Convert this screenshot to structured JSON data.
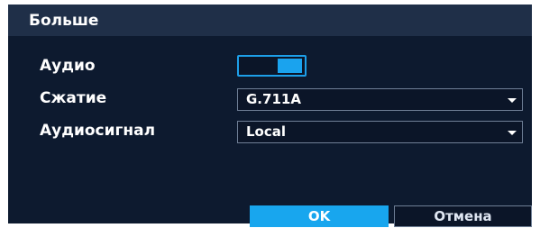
{
  "dialog": {
    "title": "Больше"
  },
  "fields": {
    "audio": {
      "label": "Аудио",
      "enabled": true
    },
    "compression": {
      "label": "Сжатие",
      "value": "G.711A"
    },
    "audio_signal": {
      "label": "Аудиосигнал",
      "value": "Local"
    }
  },
  "buttons": {
    "ok": "OK",
    "cancel": "Отмена"
  },
  "colors": {
    "accent": "#18a6ee",
    "dialog_background": "#0d1a2f",
    "titlebar_background": "#1f2f48"
  },
  "icons": {
    "dropdown": "chevron-down-icon"
  }
}
